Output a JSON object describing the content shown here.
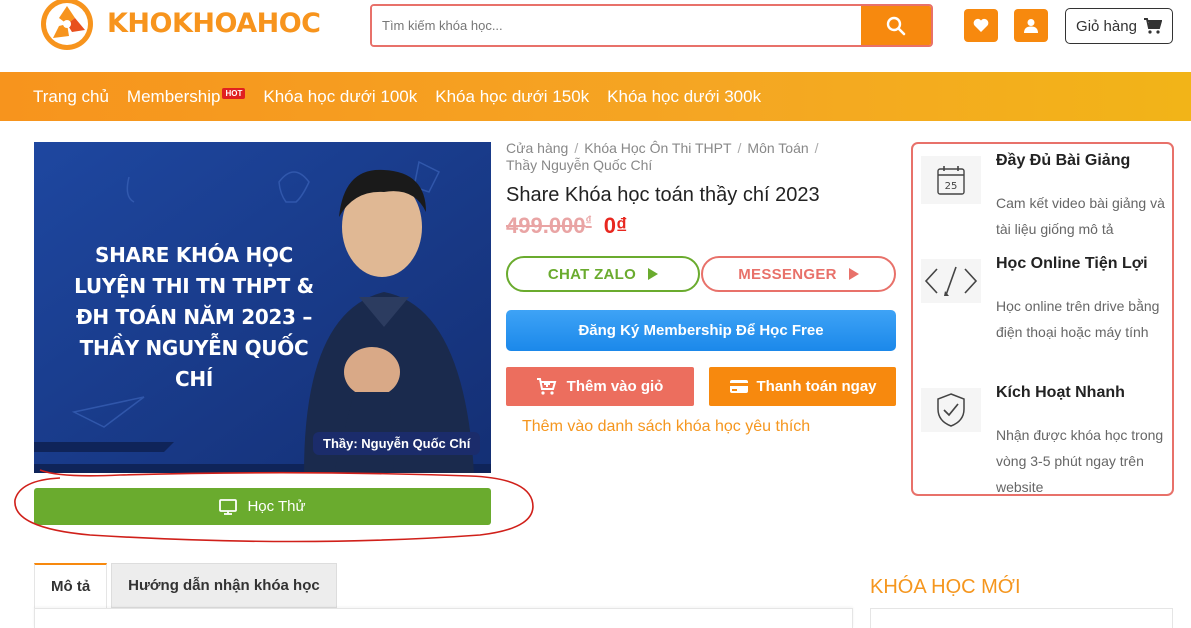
{
  "header": {
    "logo_text": "KHOKHOAHOC",
    "search_placeholder": "Tìm kiếm khóa học...",
    "cart_label": "Giỏ hàng"
  },
  "nav": {
    "items": [
      "Trang chủ",
      "Membership",
      "Khóa học dưới 100k",
      "Khóa học dưới 150k",
      "Khóa học dưới 300k"
    ],
    "hot_badge": "HOT"
  },
  "product_image": {
    "headline": "SHARE KHÓA HỌC LUYỆN THI TN THPT & ĐH TOÁN NĂM 2023 – THẦY NGUYỄN QUỐC CHÍ",
    "teacher_label": "Thầy: Nguyễn Quốc Chí"
  },
  "try_button": "Học Thử",
  "breadcrumb": [
    "Cửa hàng",
    "Khóa Học Ôn Thi THPT",
    "Môn Toán",
    "Thầy Nguyễn Quốc Chí"
  ],
  "product": {
    "title": "Share Khóa học toán thầy chí 2023",
    "old_price": "499.000",
    "currency": "₫",
    "new_price": "0₫"
  },
  "buttons": {
    "chat_zalo": "CHAT ZALO",
    "messenger": "MESSENGER",
    "membership": "Đăng Ký Membership Để Học Free",
    "add_to_cart": "Thêm vào giỏ",
    "checkout": "Thanh toán ngay",
    "wishlist": "Thêm vào danh sách khóa học yêu thích"
  },
  "features": [
    {
      "title": "Đầy Đủ Bài Giảng",
      "desc": "Cam kết video bài giảng và tài liệu giống mô tả",
      "icon": "calendar-icon",
      "icon_text": "25"
    },
    {
      "title": "Học Online Tiện Lợi",
      "desc": "Học online trên drive bằng điện thoại hoặc máy tính",
      "icon": "code-icon"
    },
    {
      "title": "Kích Hoạt Nhanh",
      "desc": "Nhận được khóa học trong vòng 3-5 phút ngay trên website",
      "icon": "shield-check-icon"
    }
  ],
  "tabs": [
    "Mô tả",
    "Hướng dẫn nhận khóa học"
  ],
  "sidebar_heading": "KHÓA HỌC MỚI",
  "colors": {
    "accent": "#f7890e",
    "green": "#6aab2e",
    "red": "#e8716a",
    "blue": "#1b88ea"
  }
}
